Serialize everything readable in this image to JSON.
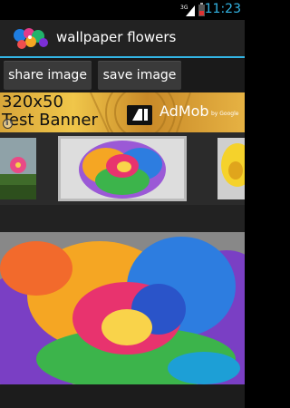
{
  "status": {
    "time": "11:23",
    "network": "3G",
    "accent_color": "#33b5e5"
  },
  "app": {
    "title": "wallpaper flowers",
    "icon": "flowers-app-icon"
  },
  "buttons": {
    "share_label": "share image",
    "save_label": "save image"
  },
  "ad": {
    "text_line1": "320x50",
    "text_line2": "Test Banner",
    "brand": "AdMob",
    "brand_sub": "by Google",
    "info_icon": "info-icon"
  },
  "gallery": {
    "thumbnails": [
      {
        "name": "pink-flower-thumb"
      },
      {
        "name": "rainbow-rose-thumb",
        "selected": true
      },
      {
        "name": "yellow-flower-thumb"
      }
    ]
  },
  "main": {
    "image": "rainbow-rose-wallpaper"
  }
}
